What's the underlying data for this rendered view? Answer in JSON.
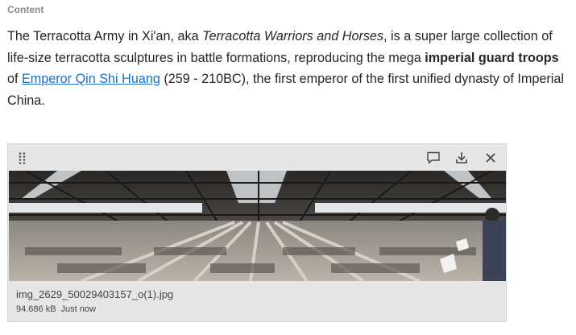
{
  "section": {
    "label": "Content"
  },
  "paragraph": {
    "part1": "The Terracotta Army in Xi'an, aka ",
    "italic": "Terracotta Warriors and Horses",
    "part2": ", is a super large collection of life-size terracotta sculptures in battle formations, reproducing the mega ",
    "bold": "imperial guard troops",
    "part3": " of ",
    "link": "Emperor Qin Shi Huang",
    "part4": " (259 - 210BC), the first emperor of the first unified dynasty of Imperial China."
  },
  "attachment": {
    "filename": "img_2629_50029403157_o(1).jpg",
    "size": "94.686 kB",
    "time": "Just now",
    "image_description_icon": "terracotta-army-photo",
    "actions": [
      "comment-icon",
      "download-icon",
      "close-icon"
    ]
  },
  "colors": {
    "link": "#1a6fc9",
    "label": "#8a8a8a",
    "card_bg": "#e6e6e6"
  }
}
